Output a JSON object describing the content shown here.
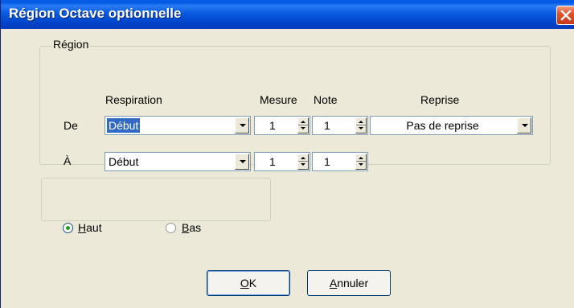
{
  "window": {
    "title": "Région Octave optionnelle"
  },
  "group_region": {
    "legend": "Région",
    "headers": {
      "respiration": "Respiration",
      "mesure": "Mesure",
      "note": "Note",
      "reprise": "Reprise"
    },
    "row_from": {
      "label": "De",
      "respiration": "Début",
      "mesure": "1",
      "note": "1",
      "reprise": "Pas de reprise"
    },
    "row_to": {
      "label": "À",
      "respiration": "Début",
      "mesure": "1",
      "note": "1"
    }
  },
  "direction": {
    "options": [
      {
        "label_first": "H",
        "label_rest": "aut",
        "checked": true
      },
      {
        "label_first": "B",
        "label_rest": "as",
        "checked": false
      }
    ]
  },
  "buttons": {
    "ok_first": "O",
    "ok_rest": "K",
    "cancel_first": "A",
    "cancel_rest": "nnuler"
  }
}
